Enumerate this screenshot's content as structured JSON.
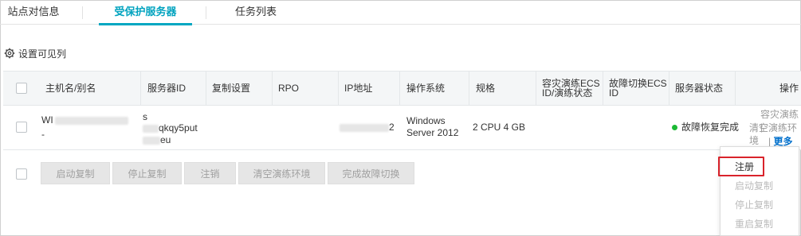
{
  "tabs": [
    {
      "label": "站点对信息"
    },
    {
      "label": "受保护服务器"
    },
    {
      "label": "任务列表"
    }
  ],
  "toolbar": {
    "column_settings": "设置可见列"
  },
  "table": {
    "headers": {
      "host": "主机名/别名",
      "server_id": "服务器ID",
      "replication": "复制设置",
      "rpo": "RPO",
      "ip": "IP地址",
      "os": "操作系统",
      "spec": "规格",
      "drill_ecs_1": "容灾演练ECS",
      "drill_ecs_2": "ID/演练状态",
      "failover_ecs_1": "故障切换ECS",
      "failover_ecs_2": "ID",
      "server_status": "服务器状态",
      "actions": "操作"
    },
    "row": {
      "host_prefix": "WI",
      "host_alias": "-",
      "server_id_line1": "s",
      "server_id_line2": "qkqy5put",
      "server_id_line3": "eu",
      "ip_suffix": "2",
      "os_line1": "Windows",
      "os_line2": "Server 2012",
      "spec": "2 CPU 4 GB",
      "status": "故障恢复完成",
      "status_color": "#1bb934",
      "action_drill": "容灾演练 |",
      "action_clear": "清空演练环境",
      "action_sep": "|",
      "action_more": "更多"
    }
  },
  "buttons": {
    "start": "启动复制",
    "stop": "停止复制",
    "cancel": "注销",
    "clear": "清空演练环境",
    "complete": "完成故障切换"
  },
  "dropdown": {
    "items": [
      "注册",
      "启动复制",
      "停止复制",
      "重启复制"
    ]
  },
  "colors": {
    "accent": "#00a7c2",
    "link": "#0070cc",
    "highlight": "#d9232b"
  }
}
